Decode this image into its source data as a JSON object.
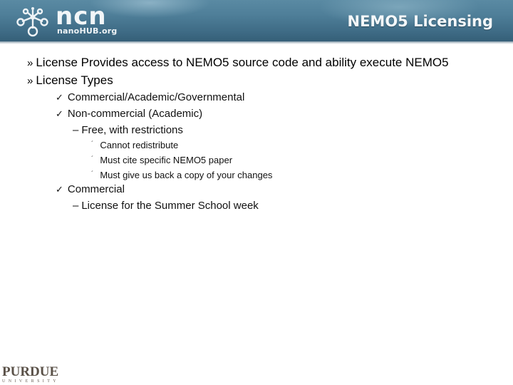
{
  "header": {
    "logo": {
      "icon": "molecule-network-icon",
      "wordmark": "ncn",
      "subtitle": "nanoHUB.org"
    },
    "title": "NEMO5 Licensing"
  },
  "content": {
    "items": [
      {
        "level": 1,
        "bullet": "»",
        "text": "License Provides access to NEMO5 source code and ability execute NEMO5"
      },
      {
        "level": 1,
        "bullet": "»",
        "text": "License Types"
      },
      {
        "level": 2,
        "bullet": "✓",
        "text": "Commercial/Academic/Governmental"
      },
      {
        "level": 2,
        "bullet": "✓",
        "text": "Non-commercial (Academic)"
      },
      {
        "level": 3,
        "bullet": "–",
        "text": "Free, with restrictions"
      },
      {
        "level": 4,
        "bullet": "´",
        "text": "Cannot redistribute"
      },
      {
        "level": 4,
        "bullet": "´",
        "text": "Must cite specific NEMO5 paper"
      },
      {
        "level": 4,
        "bullet": "´",
        "text": "Must give us back a copy of your changes"
      },
      {
        "level": 2,
        "bullet": "✓",
        "text": "Commercial"
      },
      {
        "level": 3,
        "bullet": "–",
        "text": "License for the Summer School week"
      }
    ]
  },
  "footer": {
    "logo_name": "PURDUE",
    "logo_sub": "UNIVERSITY"
  }
}
